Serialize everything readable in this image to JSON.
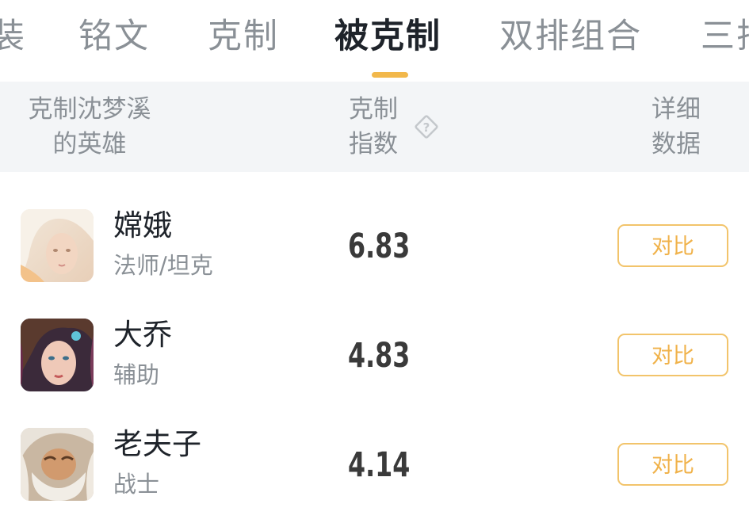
{
  "tabs": [
    {
      "label": "装"
    },
    {
      "label": "铭文"
    },
    {
      "label": "克制"
    },
    {
      "label": "被克制",
      "active": true
    },
    {
      "label": "双排组合"
    },
    {
      "label": "三排"
    }
  ],
  "header": {
    "col1_line1": "克制沈梦溪",
    "col1_line2": "的英雄",
    "col2_line1": "克制",
    "col2_line2": "指数",
    "col3_line1": "详细",
    "col3_line2": "数据",
    "help_icon": "question-diamond-icon"
  },
  "rows": [
    {
      "name": "嫦娥",
      "role": "法师/坦克",
      "score": "6.83",
      "action": "对比"
    },
    {
      "name": "大乔",
      "role": "辅助",
      "score": "4.83",
      "action": "对比"
    },
    {
      "name": "老夫子",
      "role": "战士",
      "score": "4.14",
      "action": "对比"
    }
  ],
  "colors": {
    "accent": "#f2b84b",
    "header_bg": "#f3f5f7",
    "muted_text": "#8a9096"
  }
}
